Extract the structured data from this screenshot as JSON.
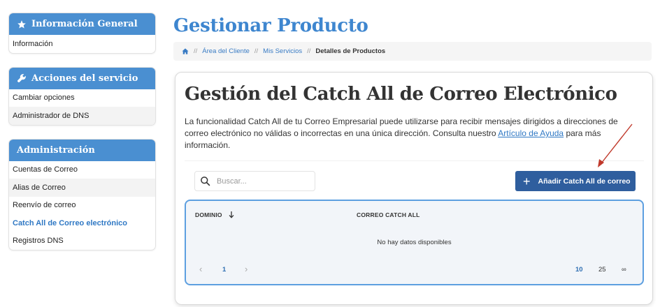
{
  "sidebar": {
    "general": {
      "title": "Información General",
      "items": [
        {
          "label": "Información"
        }
      ]
    },
    "service": {
      "title": "Acciones del servicio",
      "items": [
        {
          "label": "Cambiar opciones"
        },
        {
          "label": "Administrador de DNS"
        }
      ]
    },
    "admin": {
      "title": "Administración",
      "items": [
        {
          "label": "Cuentas de Correo"
        },
        {
          "label": "Alias de Correo"
        },
        {
          "label": "Reenvío de correo"
        },
        {
          "label": "Catch All de Correo electrónico"
        },
        {
          "label": "Registros DNS"
        }
      ]
    }
  },
  "header": {
    "title": "Gestionar Producto",
    "breadcrumb": {
      "home_icon": "home-icon",
      "items": [
        "Área del Cliente",
        "Mis Servicios",
        "Detalles de Productos"
      ],
      "separator": "//"
    }
  },
  "main": {
    "title": "Gestión del Catch All de Correo Electrónico",
    "description_pre": "La funcionalidad Catch All de tu Correo Empresarial puede utilizarse para recibir mensajes dirigidos a direcciones de correo electrónico no válidas o incorrectas en una única dirección. Consulta nuestro ",
    "description_link": "Artículo de Ayuda",
    "description_post": " para más información.",
    "search_placeholder": "Buscar...",
    "add_button": "Añadir Catch All de correo",
    "table": {
      "columns": [
        "DOMINIO",
        "CORREO CATCH ALL"
      ],
      "empty_message": "No hay datos disponibles",
      "pagination": {
        "current_page": "1",
        "page_sizes": [
          "10",
          "25",
          "∞"
        ]
      }
    }
  },
  "colors": {
    "accent": "#4a8fd1",
    "title_blue": "#3e86cf",
    "button": "#2f5e9e",
    "table_border": "#5d9fe0",
    "arrow": "#c0392b"
  }
}
